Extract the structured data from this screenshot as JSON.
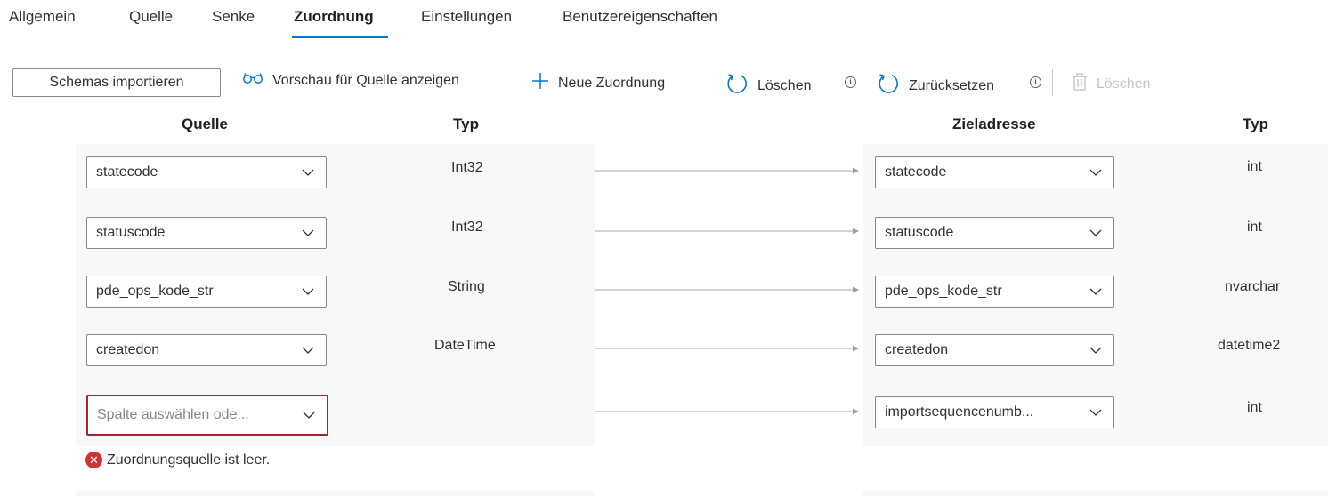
{
  "tabs": [
    {
      "label": "Allgemein",
      "active": false
    },
    {
      "label": "Quelle",
      "active": false
    },
    {
      "label": "Senke",
      "active": false
    },
    {
      "label": "Zuordnung",
      "active": true
    },
    {
      "label": "Einstellungen",
      "active": false
    },
    {
      "label": "Benutzereigenschaften",
      "active": false
    }
  ],
  "toolbar": {
    "import_schemas": "Schemas importieren",
    "preview_source": "Vorschau für Quelle anzeigen",
    "new_mapping": "Neue Zuordnung",
    "clear": "Löschen",
    "reset": "Zurücksetzen",
    "delete": "Löschen",
    "info_glyph": "i"
  },
  "headers": {
    "source": "Quelle",
    "source_type": "Typ",
    "destination": "Zieladresse",
    "destination_type": "Typ"
  },
  "rows": [
    {
      "source": "statecode",
      "source_type": "Int32",
      "destination": "statecode",
      "destination_type": "int"
    },
    {
      "source": "statuscode",
      "source_type": "Int32",
      "destination": "statuscode",
      "destination_type": "int"
    },
    {
      "source": "pde_ops_kode_str",
      "source_type": "String",
      "destination": "pde_ops_kode_str",
      "destination_type": "nvarchar"
    },
    {
      "source": "createdon",
      "source_type": "DateTime",
      "destination": "createdon",
      "destination_type": "datetime2"
    },
    {
      "source": "Spalte auswählen ode...",
      "source_type": "",
      "destination": "importsequencenumb...",
      "destination_type": "int"
    }
  ],
  "error": {
    "message": "Zuordnungsquelle ist leer.",
    "glyph": "✕",
    "color": "#d13438"
  },
  "colors": {
    "accent": "#0078d4",
    "error_border": "#a4262c",
    "panel_bg": "#f8f8f8"
  }
}
